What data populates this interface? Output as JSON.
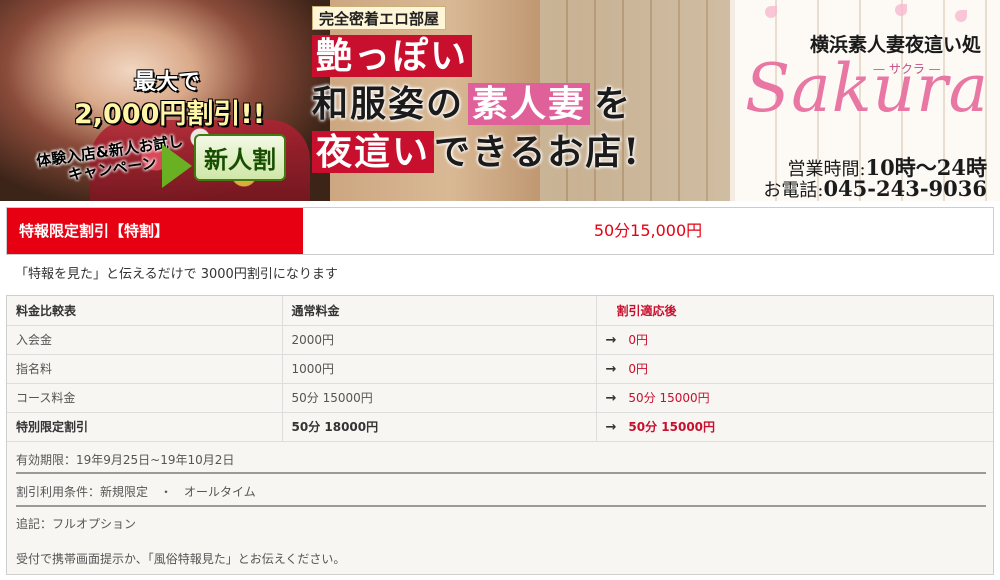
{
  "banner": {
    "tagline": "完全密着エロ部屋",
    "headline": {
      "line1": "艶っぽい",
      "line2_a": "和服姿の",
      "line2_b": "素人妻",
      "line2_c": "を",
      "line3_a": "夜這い",
      "line3_b": "できるお店!"
    },
    "campaign": {
      "max": "最大で",
      "discount": "2,000円割引!!",
      "trial": "体験入店&新人お試しキャンペーン",
      "new_badge": "新人割"
    },
    "brand": {
      "shop_name": "横浜素人妻夜這い処",
      "logo": "Sakura",
      "reading": "— サクラ —",
      "hours_label": "営業時間:",
      "hours_value": "10時～24時",
      "phone_label": "お電話:",
      "phone_value": "045-243-9036"
    }
  },
  "special": {
    "label": "特報限定割引【特割】",
    "price": "50分15,000円"
  },
  "note": "「特報を見た」と伝えるだけで 3000円割引になります",
  "table": {
    "headers": [
      "料金比較表",
      "通常料金",
      "割引適応後"
    ],
    "rows": [
      {
        "item": "入会金",
        "normal": "2000円",
        "after": "0円"
      },
      {
        "item": "指名料",
        "normal": "1000円",
        "after": "0円"
      },
      {
        "item": "コース料金",
        "normal": "50分 15000円",
        "after": "50分 15000円"
      },
      {
        "item": "特別限定割引",
        "normal": "50分 18000円",
        "after": "50分 15000円"
      }
    ],
    "arrow_icon": "→"
  },
  "validity": "有効期限：19年9月25日~19年10月2日",
  "conditions": "割引利用条件：新規限定　・　オールタイム",
  "postscript": "追記：フルオプション",
  "instruction": "受付で携帯画面提示か、「風俗特報見た」とお伝えください。",
  "colors": {
    "accent_red": "#e60012",
    "brand_pink": "#e877a4"
  }
}
